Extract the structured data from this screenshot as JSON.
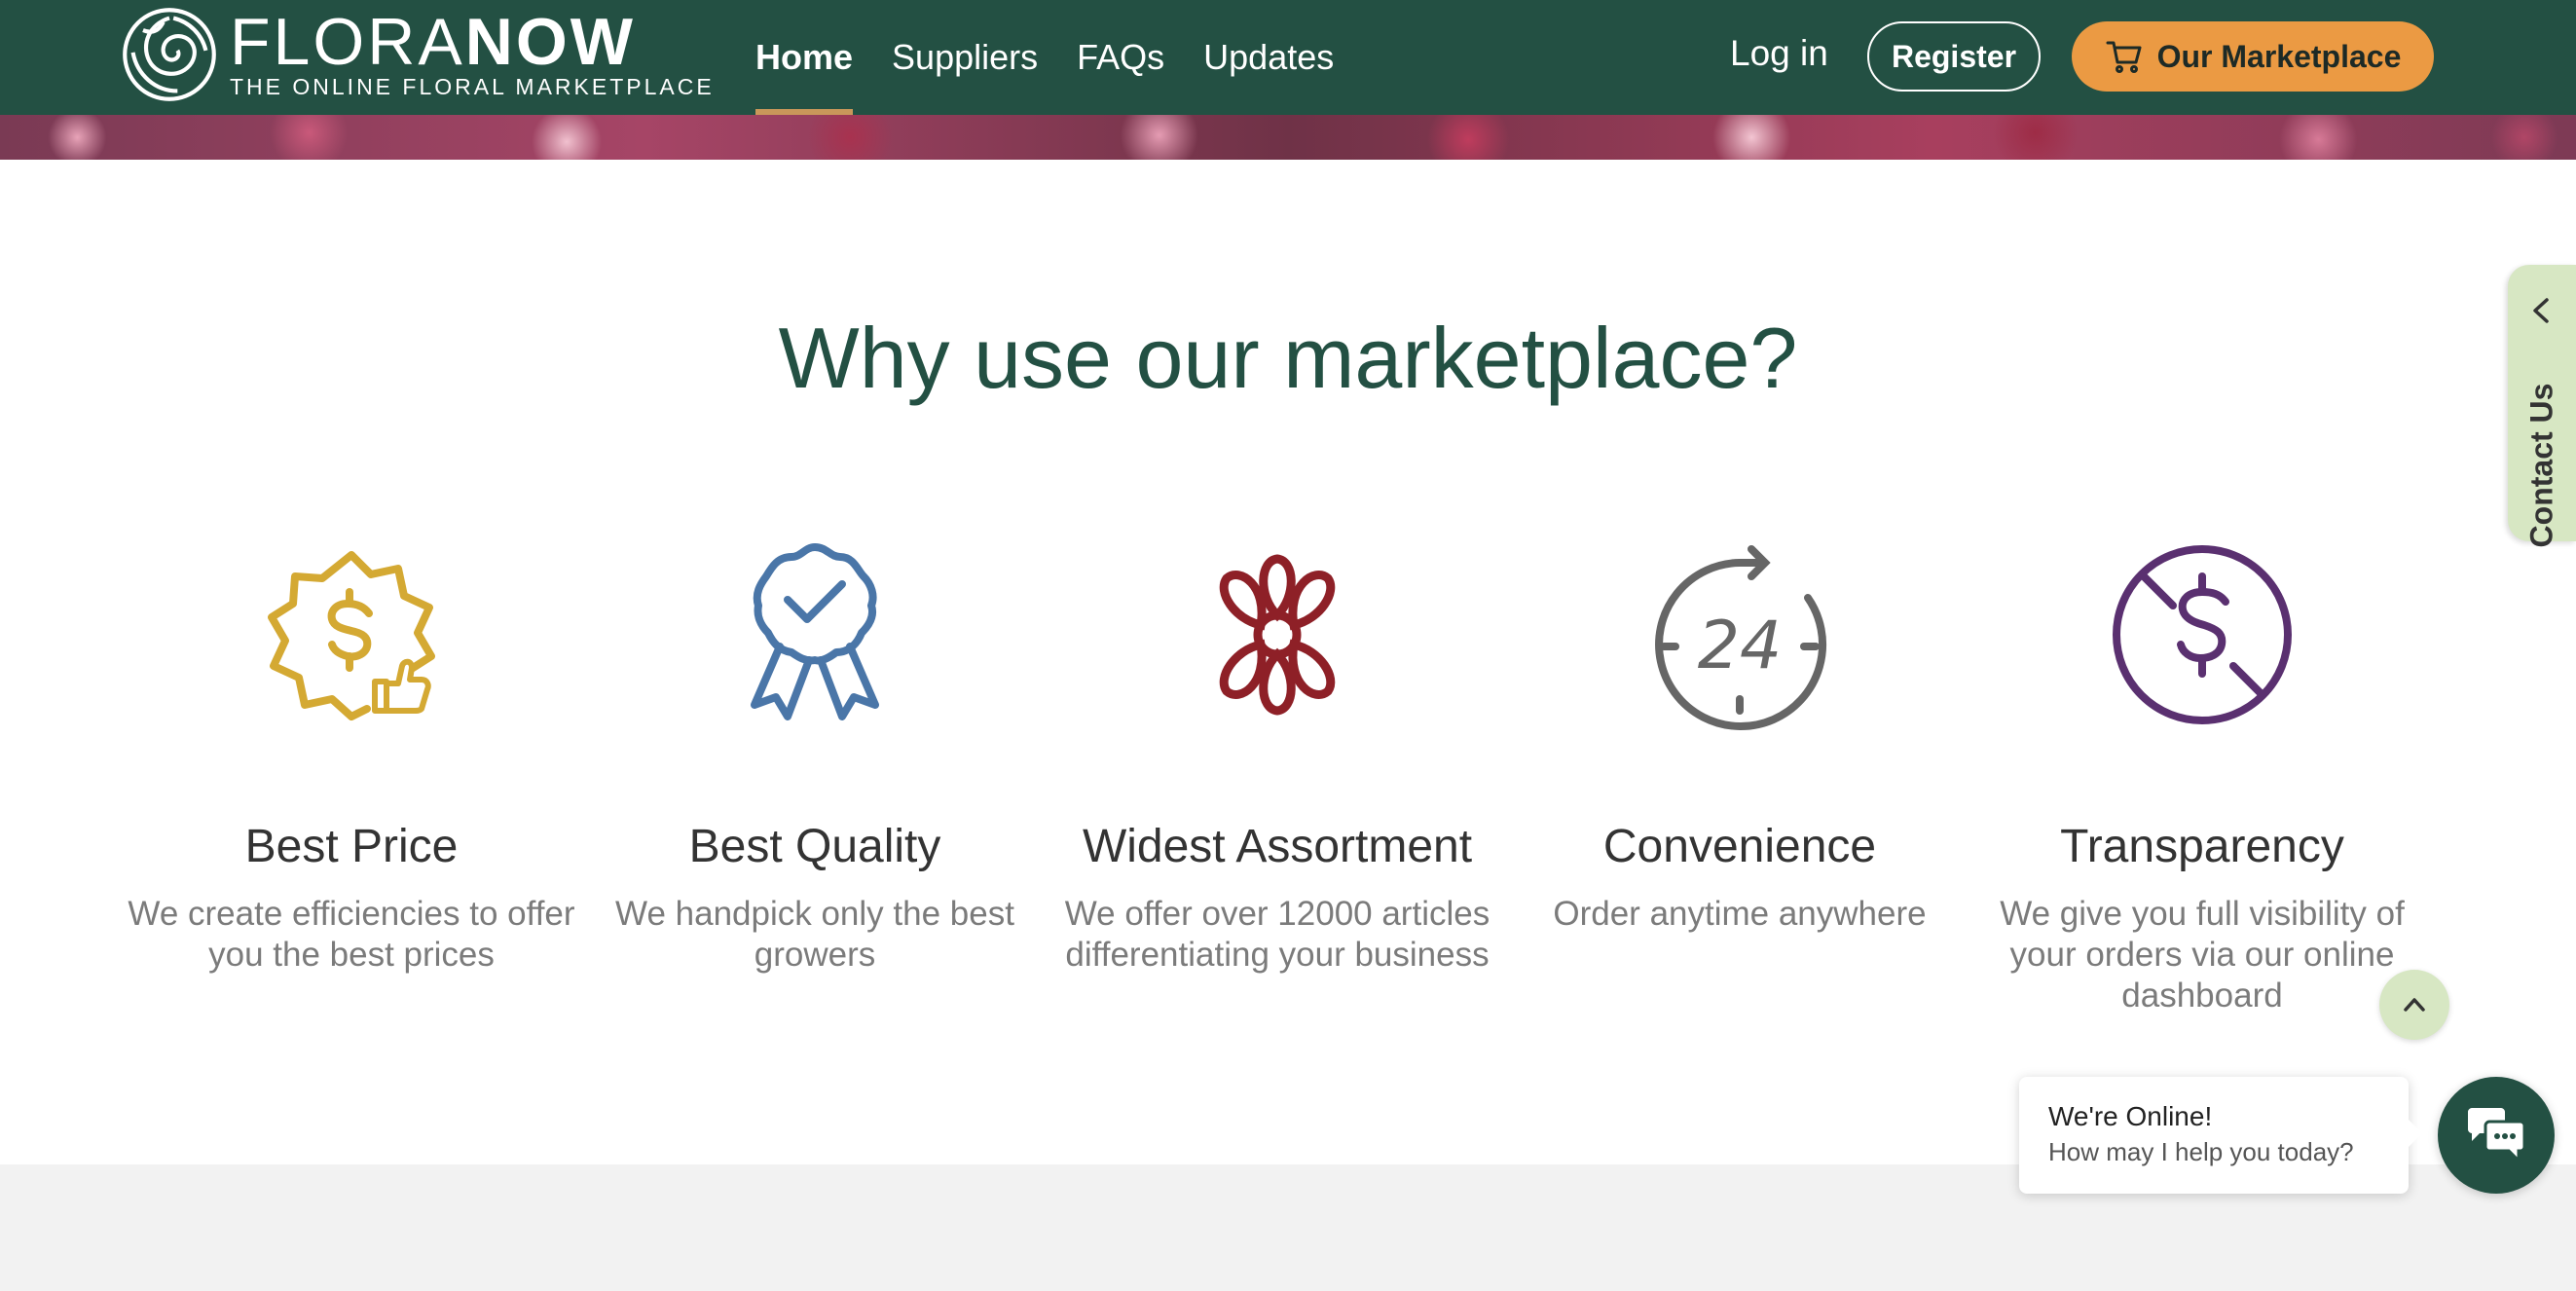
{
  "header": {
    "logo": {
      "word_light": "FLORA",
      "word_bold": "NOW",
      "tagline": "THE ONLINE FLORAL MARKETPLACE",
      "icon": "rose-logo-icon"
    },
    "nav": [
      {
        "label": "Home",
        "active": true
      },
      {
        "label": "Suppliers",
        "active": false
      },
      {
        "label": "FAQs",
        "active": false
      },
      {
        "label": "Updates",
        "active": false
      }
    ],
    "login_label": "Log in",
    "register_label": "Register",
    "marketplace_label": "Our Marketplace",
    "marketplace_icon": "cart-icon"
  },
  "section": {
    "title": "Why use our marketplace?",
    "features": [
      {
        "title": "Best Price",
        "desc": "We create efficiencies to offer you the best prices",
        "icon": "price-badge-icon",
        "color": "#d4a933"
      },
      {
        "title": "Best Quality",
        "desc": "We handpick only the best growers",
        "icon": "award-ribbon-icon",
        "color": "#4a76a8"
      },
      {
        "title": "Widest Assortment",
        "desc": "We offer over 12000 articles differentiating your business",
        "icon": "flower-icon",
        "color": "#8e2027"
      },
      {
        "title": "Convenience",
        "desc": "Order anytime anywhere",
        "icon": "clock-24-icon",
        "color": "#666666",
        "icon_text": "24"
      },
      {
        "title": "Transparency",
        "desc": "We give you full visibility of your orders via our online dashboard",
        "icon": "no-hidden-fees-icon",
        "color": "#5a3070"
      }
    ]
  },
  "contact_tab": {
    "label": "Contact Us",
    "icon": "chevron-left-icon"
  },
  "scroll_top": {
    "icon": "chevron-up-icon"
  },
  "chat": {
    "title": "We're Online!",
    "subtitle": "How may I help you today?",
    "icon": "chat-bubbles-icon"
  },
  "colors": {
    "brand_green": "#235043",
    "accent_orange": "#eb9a43",
    "active_underline": "#c9975a",
    "light_green": "#d7e7c3"
  }
}
